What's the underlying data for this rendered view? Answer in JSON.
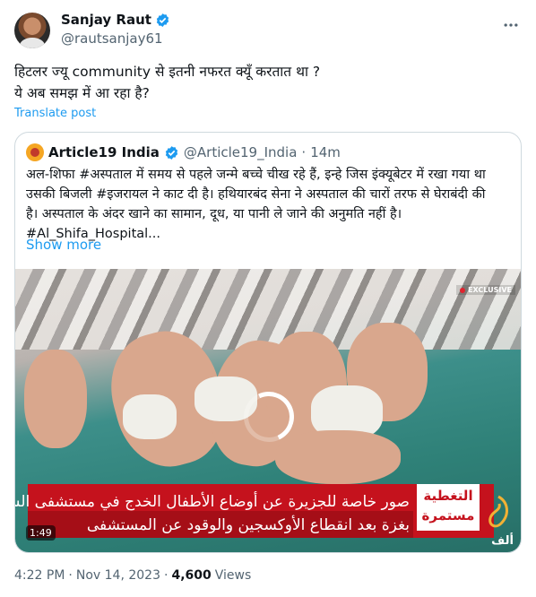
{
  "author": {
    "name": "Sanjay Raut",
    "handle": "@rautsanjay61",
    "verified_color": "#1d9bf0"
  },
  "tweet": {
    "line1": "हिटलर ज्यू community से इतनी नफरत क्यूँ करतात था ?",
    "line2": "ये अब समझ में आ रहा है?",
    "translate_label": "Translate post"
  },
  "quote": {
    "name": "Article19 India",
    "handle": "@Article19_India",
    "separator": "·",
    "time": "14m",
    "text_line1": "अल-शिफा #अस्पताल में समय से पहले जन्मे बच्चे चीख रहे हैं, इन्हे जिस इंक्यूबेटर में रखा गया था",
    "text_line2": "उसकी बिजली #इजरायल  ने काट दी है। हथियारबंद सेना ने अस्पताल की चारों तरफ से घेराबंदी की",
    "text_line3": "है। अस्पताल के अंदर खाने का सामान, दूध, या पानी ले जाने की अनुमति नहीं है।",
    "text_line4": "#Al_Shifa_Hospital...",
    "show_more": "Show more"
  },
  "video": {
    "badge": "EXCLUSIVE",
    "caption_line1": "صور خاصة للجزيرة عن أوضاع الأطفال الخدج في مستشفى الشفاء",
    "caption_line2": "بغزة بعد انقطاع الأوكسجين والوقود عن المستشفى",
    "coverage_line1": "التغطية",
    "coverage_line2": "مستمرة",
    "duration": "1:49",
    "channel_text": "ألف"
  },
  "footer": {
    "time": "4:22 PM",
    "separator1": "·",
    "date": "Nov 14, 2023",
    "separator2": "·",
    "views": "4,600",
    "views_label": "Views"
  }
}
